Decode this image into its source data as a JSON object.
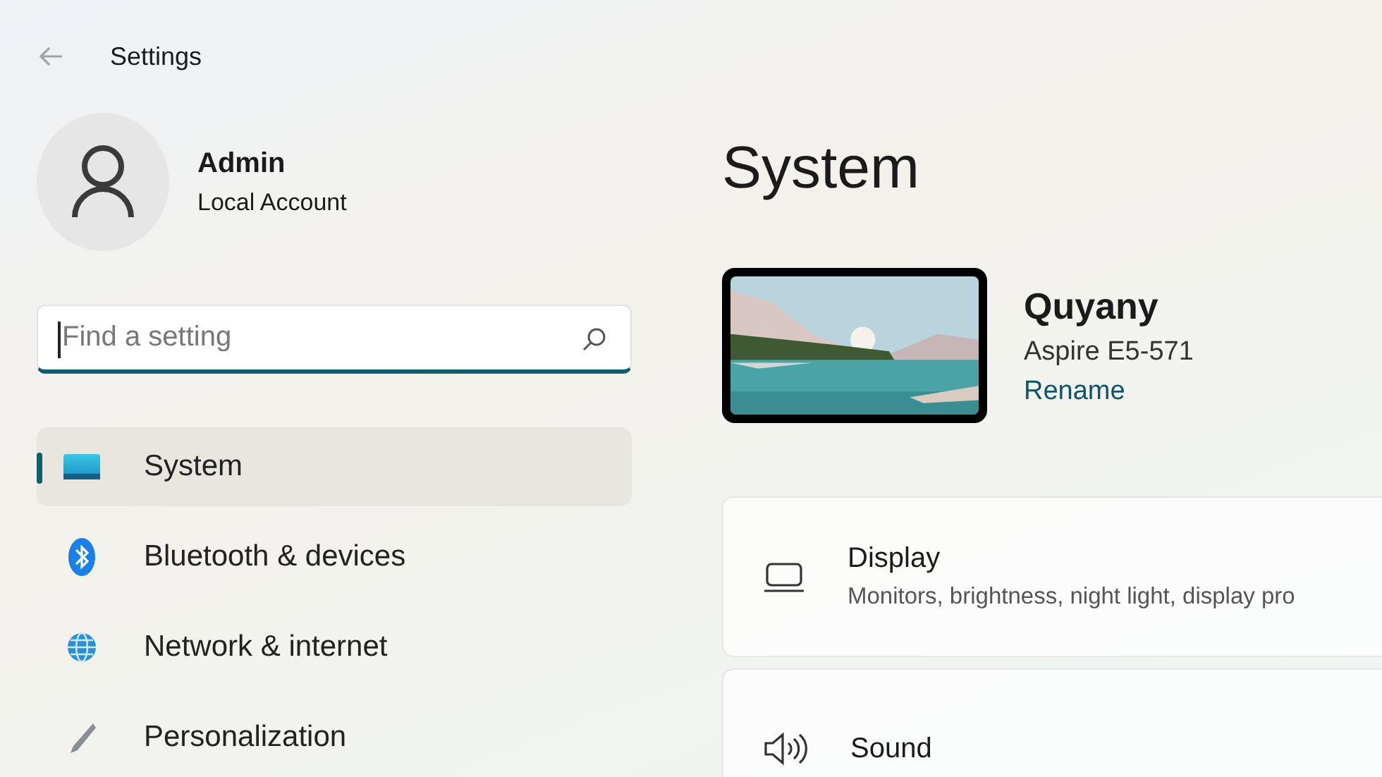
{
  "window": {
    "title": "Settings"
  },
  "account": {
    "name": "Admin",
    "type": "Local Account"
  },
  "search": {
    "placeholder": "Find a setting"
  },
  "sidebar": {
    "items": [
      {
        "label": "System",
        "kind": "system",
        "selected": true
      },
      {
        "label": "Bluetooth & devices",
        "kind": "bluetooth",
        "selected": false
      },
      {
        "label": "Network & internet",
        "kind": "network",
        "selected": false
      },
      {
        "label": "Personalization",
        "kind": "brush",
        "selected": false
      }
    ]
  },
  "page": {
    "title": "System",
    "device": {
      "name": "Quyany",
      "model": "Aspire E5-571",
      "rename": "Rename"
    },
    "cards": [
      {
        "kind": "display",
        "title": "Display",
        "description": "Monitors, brightness, night light, display pro"
      },
      {
        "kind": "sound",
        "title": "Sound"
      }
    ]
  }
}
